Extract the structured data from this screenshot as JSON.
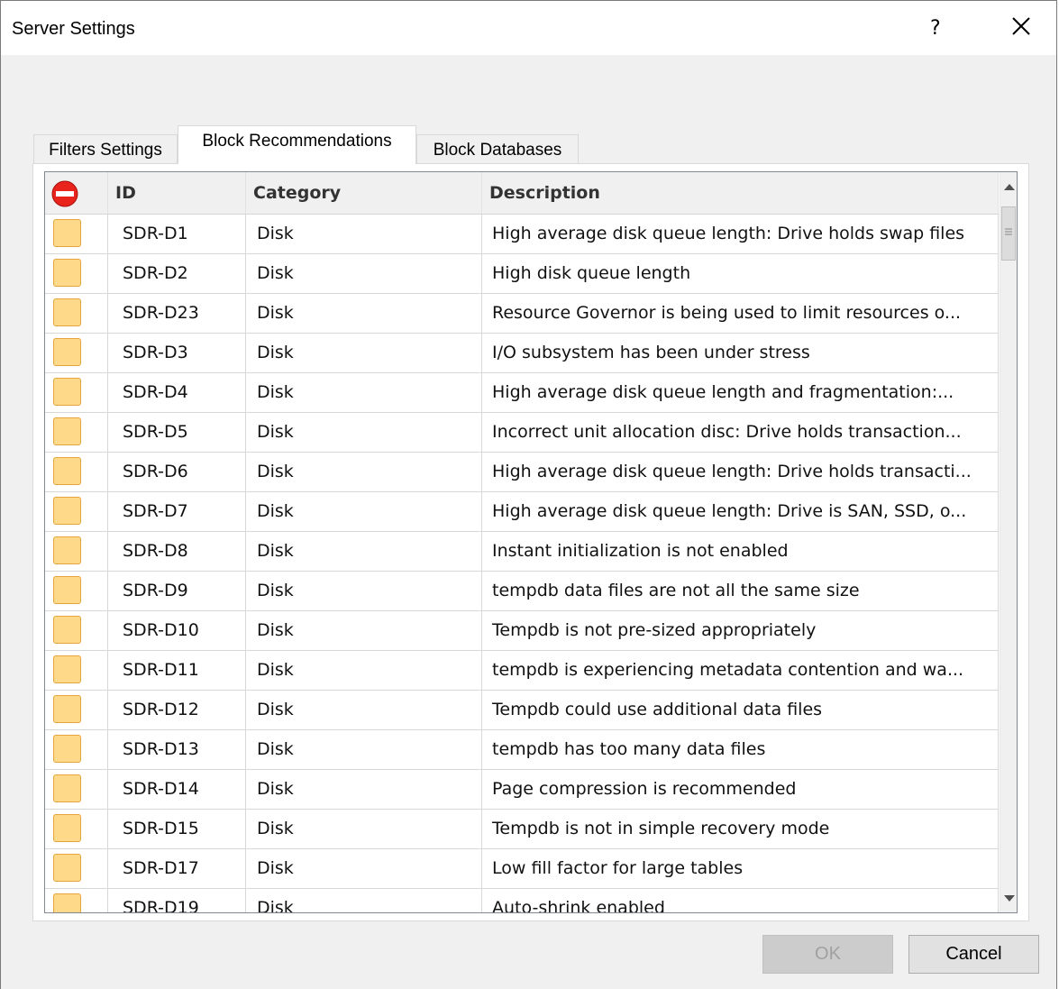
{
  "window": {
    "title": "Server Settings",
    "help_label": "?"
  },
  "tabs": [
    {
      "label": "Filters Settings"
    },
    {
      "label": "Block Recommendations"
    },
    {
      "label": "Block Databases"
    }
  ],
  "grid": {
    "columns": {
      "block_icon": "block-icon",
      "id": "ID",
      "category": "Category",
      "description": "Description"
    },
    "rows": [
      {
        "id": "SDR-D1",
        "category": "Disk",
        "description": "High average disk queue length: Drive holds swap files"
      },
      {
        "id": "SDR-D2",
        "category": "Disk",
        "description": "High disk queue length"
      },
      {
        "id": "SDR-D23",
        "category": "Disk",
        "description": "Resource Governor is being used to limit resources o..."
      },
      {
        "id": "SDR-D3",
        "category": "Disk",
        "description": "I/O subsystem has been under stress"
      },
      {
        "id": "SDR-D4",
        "category": "Disk",
        "description": "High average disk queue length and fragmentation:..."
      },
      {
        "id": "SDR-D5",
        "category": "Disk",
        "description": "Incorrect unit allocation disc: Drive holds transaction..."
      },
      {
        "id": "SDR-D6",
        "category": "Disk",
        "description": "High average disk queue length: Drive holds transacti..."
      },
      {
        "id": "SDR-D7",
        "category": "Disk",
        "description": "High average disk queue length: Drive is SAN, SSD, o..."
      },
      {
        "id": "SDR-D8",
        "category": "Disk",
        "description": "Instant initialization is not enabled"
      },
      {
        "id": "SDR-D9",
        "category": "Disk",
        "description": "tempdb data files are not all the same size"
      },
      {
        "id": "SDR-D10",
        "category": "Disk",
        "description": "Tempdb is not pre-sized appropriately"
      },
      {
        "id": "SDR-D11",
        "category": "Disk",
        "description": "tempdb is experiencing metadata contention and wa..."
      },
      {
        "id": "SDR-D12",
        "category": "Disk",
        "description": "Tempdb could use additional data files"
      },
      {
        "id": "SDR-D13",
        "category": "Disk",
        "description": "tempdb has too many data files"
      },
      {
        "id": "SDR-D14",
        "category": "Disk",
        "description": "Page compression is recommended"
      },
      {
        "id": "SDR-D15",
        "category": "Disk",
        "description": "Tempdb is not in simple recovery mode"
      },
      {
        "id": "SDR-D17",
        "category": "Disk",
        "description": "Low fill factor for large tables"
      },
      {
        "id": "SDR-D19",
        "category": "Disk",
        "description": "Auto-shrink enabled"
      }
    ]
  },
  "buttons": {
    "ok": "OK",
    "cancel": "Cancel"
  },
  "colors": {
    "row_icon_fill": "#ffd98a",
    "row_icon_border": "#e6a53c",
    "block_icon_red": "#e8241c"
  }
}
